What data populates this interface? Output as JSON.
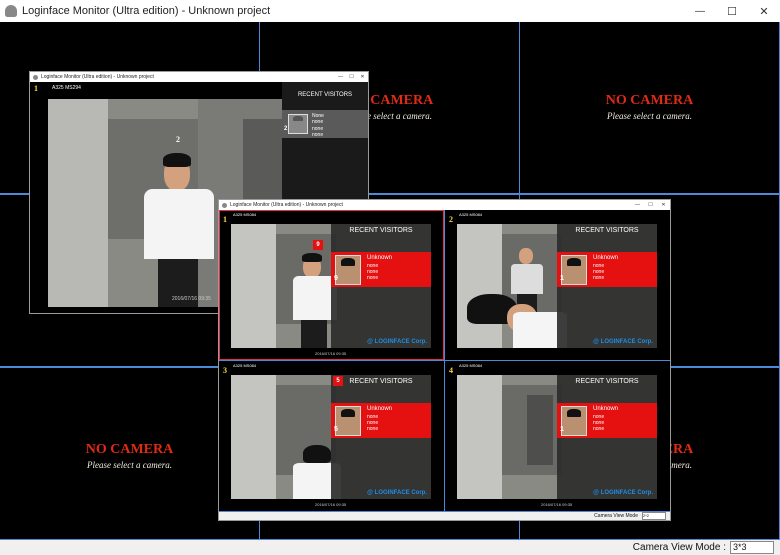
{
  "main_window": {
    "title": "Loginface Monitor (Ultra edition) - Unknown project",
    "status_label": "Camera View Mode :",
    "view_mode": "3*3"
  },
  "grid_tiles": [
    {
      "title": "NO CAMERA",
      "subtitle": "Please select a camera."
    },
    {
      "title": "NO CAMERA",
      "subtitle": "Please select a camera."
    },
    {
      "title": "NO CAMERA",
      "subtitle": "Please select a camera."
    },
    {
      "title": "NO CAMERA",
      "subtitle": "Please select a camera."
    }
  ],
  "window1": {
    "title": "Loginface Monitor (Ultra edition) - Unknown project",
    "cam_number": "1",
    "cam_label": "A325 MS294",
    "panel_title": "RECENT VISITORS",
    "visitor": {
      "num": "2",
      "lines": [
        "None",
        "none",
        "none",
        "none"
      ]
    },
    "person_num": "2",
    "timestamp": "2016/07/16  09:35"
  },
  "window2": {
    "title": "Loginface Monitor (Ultra edition) - Unknown project",
    "status_label": "Camera View Mode",
    "view_mode": "2*2",
    "cams": [
      {
        "num": "1",
        "label": "A325 MS084",
        "panel_title": "RECENT VISITORS",
        "badge": "9",
        "visitor": {
          "num": "9",
          "lines": [
            "Unknown",
            "none",
            "none",
            "none"
          ]
        },
        "brand": "@ LOGINFACE Corp.",
        "timestamp": "2016/07/16  09:35"
      },
      {
        "num": "2",
        "label": "A325 MS084",
        "panel_title": "RECENT VISITORS",
        "badge": "",
        "visitor": {
          "num": "1",
          "lines": [
            "Unknown",
            "none",
            "none",
            "none"
          ]
        },
        "brand": "@ LOGINFACE Corp.",
        "timestamp": ""
      },
      {
        "num": "3",
        "label": "A325 MS084",
        "panel_title": "RECENT VISITORS",
        "badge": "5",
        "visitor": {
          "num": "5",
          "lines": [
            "Unknown",
            "none",
            "none",
            "none"
          ]
        },
        "brand": "@ LOGINFACE Corp.",
        "timestamp": "2016/07/16  09:35"
      },
      {
        "num": "4",
        "label": "A325 MS084",
        "panel_title": "RECENT VISITORS",
        "badge": "",
        "visitor": {
          "num": "1",
          "lines": [
            "Unknown",
            "none",
            "none",
            "none"
          ]
        },
        "brand": "@ LOGINFACE Corp.",
        "timestamp": "2016/07/16  09:35"
      }
    ]
  },
  "window_controls": {
    "minimize": "—",
    "maximize": "☐",
    "close": "✕"
  },
  "colors": {
    "grid_line": "#4a8ad8",
    "no_camera": "#e02a14",
    "visitor_row": "#e51010",
    "brand": "#1c8ee6",
    "cam_number": "#ffd94a"
  },
  "icons": {
    "app": "app-icon",
    "face_thumb": "face-thumbnail"
  }
}
